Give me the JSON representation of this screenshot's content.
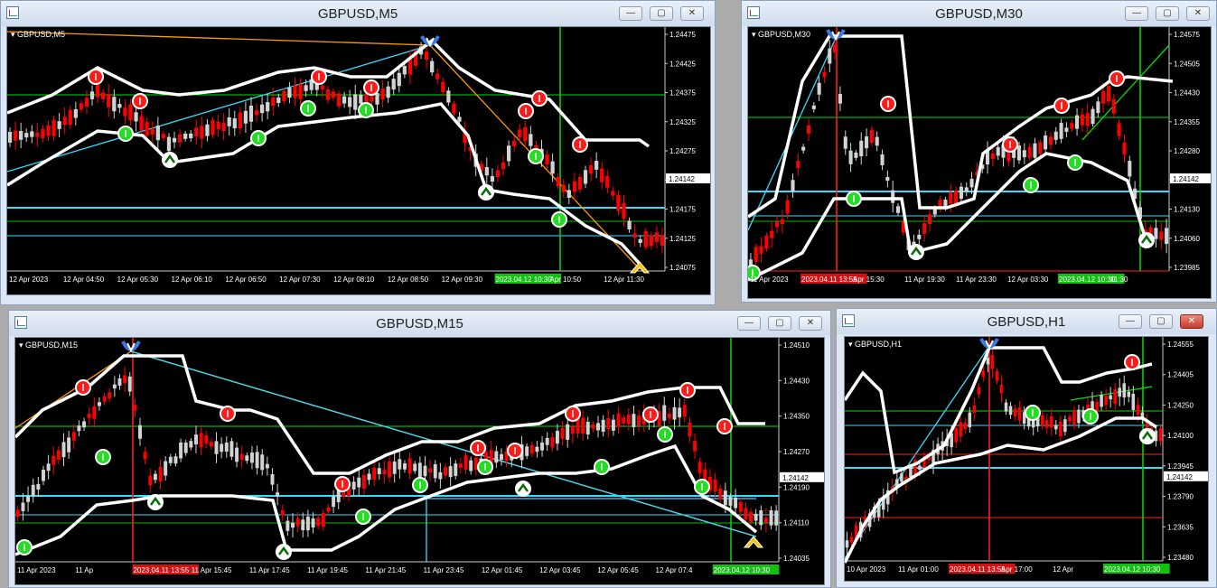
{
  "windows": [
    {
      "id": "m5",
      "title": "GBPUSD,M5",
      "symbol": "GBPUSD,M5",
      "y_ticks": [
        "1.24475",
        "1.24425",
        "1.24375",
        "1.24325",
        "1.24275",
        "1.24225",
        "1.24175",
        "1.24125",
        "1.24075"
      ],
      "x_ticks": [
        "12 Apr 2023",
        "12 Apr 04:50",
        "12 Apr 05:30",
        "12 Apr 06:10",
        "12 Apr 06:50",
        "12 Apr 07:30",
        "12 Apr 08:10",
        "12 Apr 08:50",
        "12 Apr 09:30",
        "2023.04.12 10:30",
        "Apr 10:50",
        "12 Apr 11:30"
      ],
      "price": "1.24142"
    },
    {
      "id": "m30",
      "title": "GBPUSD,M30",
      "symbol": "GBPUSD,M30",
      "y_ticks": [
        "1.24575",
        "1.24505",
        "1.24430",
        "1.24355",
        "1.24280",
        "1.24205",
        "1.24130",
        "1.24060",
        "1.23985"
      ],
      "x_ticks": [
        "11 Apr 2023",
        "2023.04.11 13:55",
        "Apr 15:30",
        "11 Apr 19:30",
        "11 Apr 23:30",
        "12 Apr 03:30",
        "2023.04.12 10:30",
        "11:30"
      ],
      "price": "1.24142"
    },
    {
      "id": "m15",
      "title": "GBPUSD,M15",
      "symbol": "GBPUSD,M15",
      "y_ticks": [
        "1.24510",
        "1.24430",
        "1.24350",
        "1.24270",
        "1.24190",
        "1.24110",
        "1.24035"
      ],
      "x_ticks": [
        "11 Apr 2023",
        "11 Ap",
        "2023.04.11 13:55",
        "11 Apr 15:45",
        "11 Apr 17:45",
        "11 Apr 19:45",
        "11 Apr 21:45",
        "11 Apr 23:45",
        "12 Apr 01:45",
        "12 Apr 03:45",
        "12 Apr 05:45",
        "12 Apr 07:4",
        "2023.04.12 10:30"
      ],
      "price": "1.24142"
    },
    {
      "id": "h1",
      "title": "GBPUSD,H1",
      "symbol": "GBPUSD,H1",
      "y_ticks": [
        "1.24555",
        "1.24405",
        "1.24250",
        "1.24100",
        "1.23945",
        "1.23790",
        "1.23635",
        "1.23480"
      ],
      "x_ticks": [
        "10 Apr 2023",
        "11 Apr 01:00",
        "2023.04.11 13:55",
        "Apr 17:00",
        "12 Apr",
        "2023.04.12 10:30"
      ],
      "price": "1.24142"
    }
  ],
  "colors": {
    "bull": "#d3d3d3",
    "bear": "#ff0000",
    "green": "#00e000",
    "bg": "#000000",
    "band": "#ffffff",
    "cyan": "#33ddff",
    "orange": "#ff9900",
    "redline": "#ff0000"
  },
  "icons": {
    "buy": "green-circle-arrow-up",
    "sell": "red-circle-arrow-down",
    "top": "blue-fork-arrow",
    "bottom": "yellow-arrow-up"
  }
}
